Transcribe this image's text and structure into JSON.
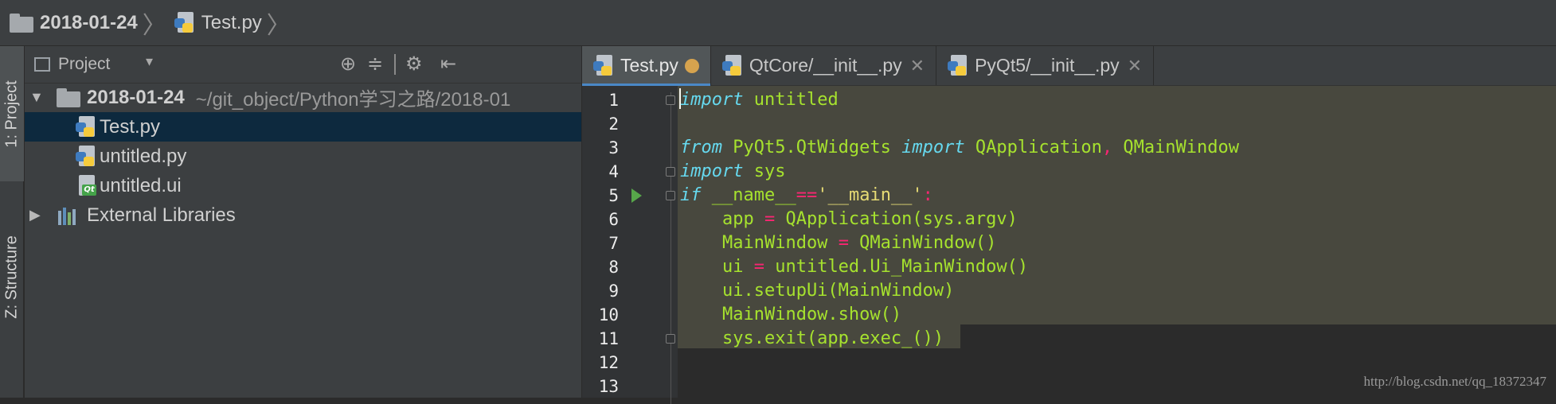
{
  "breadcrumb": {
    "folder": "2018-01-24",
    "file": "Test.py"
  },
  "tool_strip": {
    "project_tab": "1: Project",
    "structure_tab": "Z: Structure"
  },
  "project_panel": {
    "title": "Project",
    "root": {
      "name": "2018-01-24",
      "path": "~/git_object/Python学习之路/2018-01"
    },
    "files": [
      {
        "name": "Test.py",
        "icon": "python-file-icon"
      },
      {
        "name": "untitled.py",
        "icon": "python-file-icon"
      },
      {
        "name": "untitled.ui",
        "icon": "qt-ui-file-icon"
      }
    ],
    "external": "External Libraries"
  },
  "tabs": [
    {
      "label": "Test.py"
    },
    {
      "label": "QtCore/__init__.py"
    },
    {
      "label": "PyQt5/__init__.py"
    }
  ],
  "code": {
    "line_numbers": [
      "1",
      "2",
      "3",
      "4",
      "5",
      "6",
      "7",
      "8",
      "9",
      "10",
      "11",
      "12",
      "13"
    ],
    "l1": {
      "kw": "import",
      "rest": " untitled"
    },
    "l3": {
      "kw1": "from",
      "mod": " PyQt5.QtWidgets ",
      "kw2": "import",
      "c1": " QApplication",
      "comma": ",",
      "c2": " QMainWindow"
    },
    "l4": {
      "kw": "import",
      "rest": " sys"
    },
    "l5": {
      "kw": "if",
      "name": " __name__",
      "op": "==",
      "str": "'__main__'",
      "colon": ":"
    },
    "l6": {
      "ind": "    app ",
      "op": "=",
      "fn": " QApplication",
      "rest": "(sys.argv)"
    },
    "l7": {
      "ind": "    MainWindow ",
      "op": "=",
      "fn": " QMainWindow",
      "rest": "()"
    },
    "l8": {
      "ind": "    ui ",
      "op": "=",
      "rest": " untitled.Ui_MainWindow()"
    },
    "l9": {
      "text": "    ui.setupUi(MainWindow)"
    },
    "l10": {
      "text": "    MainWindow.show()"
    },
    "l11": {
      "text": "    sys.exit(app.exec_())"
    }
  },
  "watermark": "http://blog.csdn.net/qq_18372347",
  "colors": {
    "keyword": "#66D9EF",
    "operator": "#F92672",
    "function": "#A6E22E",
    "string": "#E6DB74",
    "selection": "#48483E",
    "tree_selection": "#0D293E"
  }
}
